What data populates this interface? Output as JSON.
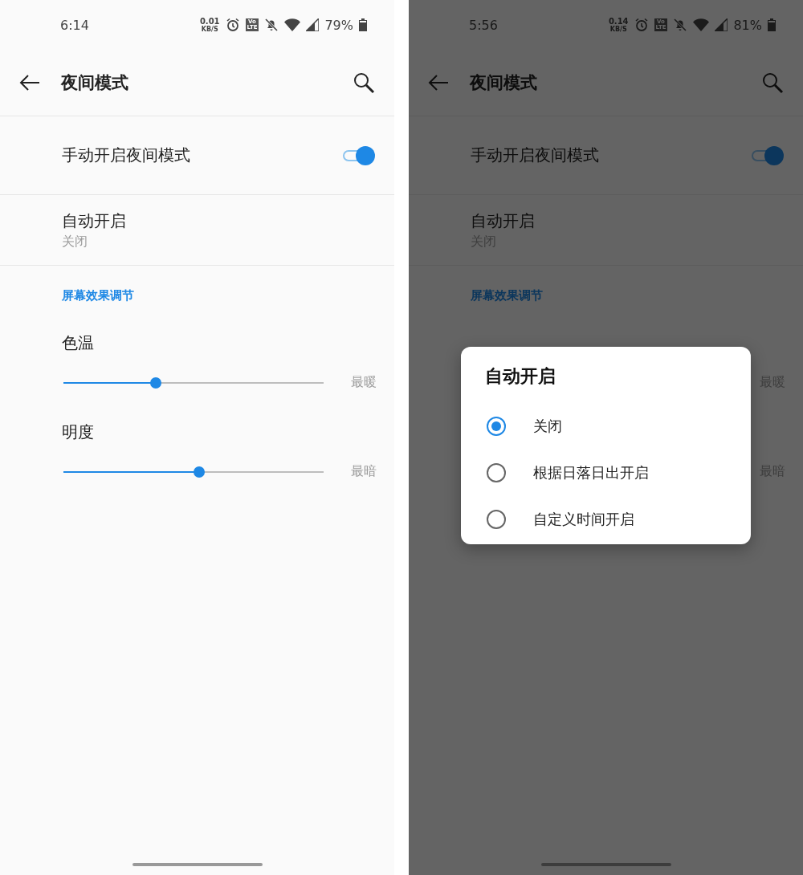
{
  "screens": [
    {
      "status_bar": {
        "time": "6:14",
        "net_speed": "0.01",
        "net_unit": "KB/S",
        "volte_top": "Vo",
        "volte_bottom": "LTE",
        "battery": "79%"
      },
      "title": "夜间模式",
      "toggle_row": {
        "label": "手动开启夜间模式",
        "on": true
      },
      "auto_row": {
        "label": "自动开启",
        "value": "关闭"
      },
      "section": "屏幕效果调节",
      "sliders": [
        {
          "label": "色温",
          "level": 0.34,
          "end_label": "最暖"
        },
        {
          "label": "明度",
          "level": 0.5,
          "end_label": "最暗"
        }
      ]
    },
    {
      "status_bar": {
        "time": "5:56",
        "net_speed": "0.14",
        "net_unit": "KB/S",
        "volte_top": "Vo",
        "volte_bottom": "LTE",
        "battery": "81%"
      },
      "title": "夜间模式",
      "toggle_row": {
        "label": "手动开启夜间模式",
        "on": true
      },
      "auto_row": {
        "label": "自动开启",
        "value": "关闭"
      },
      "section": "屏幕效果调节",
      "sliders": [
        {
          "end_label": "最暖"
        },
        {
          "end_label": "最暗"
        }
      ],
      "dialog": {
        "title": "自动开启",
        "options": [
          {
            "label": "关闭",
            "selected": true
          },
          {
            "label": "根据日落日出开启",
            "selected": false
          },
          {
            "label": "自定义时间开启",
            "selected": false
          }
        ]
      }
    }
  ]
}
